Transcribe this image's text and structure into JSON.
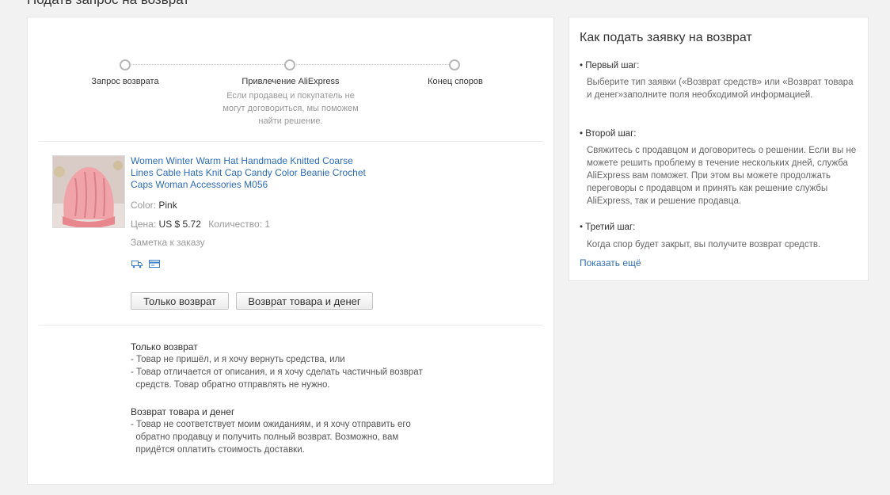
{
  "page": {
    "title": "Подать запрос на возврат"
  },
  "progress": {
    "steps": [
      {
        "label": "Запрос возврата"
      },
      {
        "label": "Привлечение AliExpress",
        "desc": "Если продавец и покупатель не могут договориться, мы поможем найти решение."
      },
      {
        "label": "Конец споров"
      }
    ]
  },
  "product": {
    "image": "pink-knitted-hat",
    "title": "Women Winter Warm Hat Handmade Knitted Coarse Lines Cable Hats Knit Cap Candy Color Beanie Crochet Caps Woman Accessories M056",
    "color_label": "Color:",
    "color_value": "Pink",
    "price_label": "Цена:",
    "price_value": "US $ 5.72",
    "quantity_label": "Количество:",
    "quantity_value": "1",
    "note_label": "Заметка к заказу",
    "icons": [
      "shipping-icon",
      "payment-card-icon"
    ]
  },
  "buttons": {
    "refund_only": "Только возврат",
    "return_and_refund": "Возврат товара и денег"
  },
  "explanations": {
    "refund_only": {
      "title": "Только возврат",
      "items": [
        "- Товар не пришёл, и я хочу вернуть средства, или",
        "- Товар отличается от описания, и я хочу сделать частичный возврат",
        "  средств. Товар обратно отправлять не нужно."
      ]
    },
    "return_and_refund": {
      "title": "Возврат товара и денег",
      "items": [
        "- Товар не соответствует моим ожиданиям, и я хочу отправить его",
        "  обратно продавцу и получить полный возврат. Возможно, вам",
        "  придётся оплатить стоимость доставки."
      ]
    }
  },
  "sidebar": {
    "title": "Как подать заявку на возврат",
    "steps": [
      {
        "label": "• Первый шаг:",
        "text": "Выберите тип заявки («Возврат средств» или «Возврат товара и денег»заполните поля необходимой информацией."
      },
      {
        "label": "• Второй шаг:",
        "text": "Свяжитесь с продавцом и договоритесь о решении. Если вы не можете решить проблему в течение нескольких дней, служба AliExpress вам поможет. При этом вы можете продолжать переговоры с продавцом и принять как решение службы AliExpress, так и решение продавца."
      },
      {
        "label": "• Третий шаг:",
        "text": "Когда спор будет закрыт, вы получите возврат средств."
      }
    ],
    "show_more": "Показать ещё"
  },
  "colors": {
    "link": "#2d6cb6",
    "muted": "#999999",
    "card_bg": "#ffffff",
    "page_bg": "#f2f2f2"
  }
}
